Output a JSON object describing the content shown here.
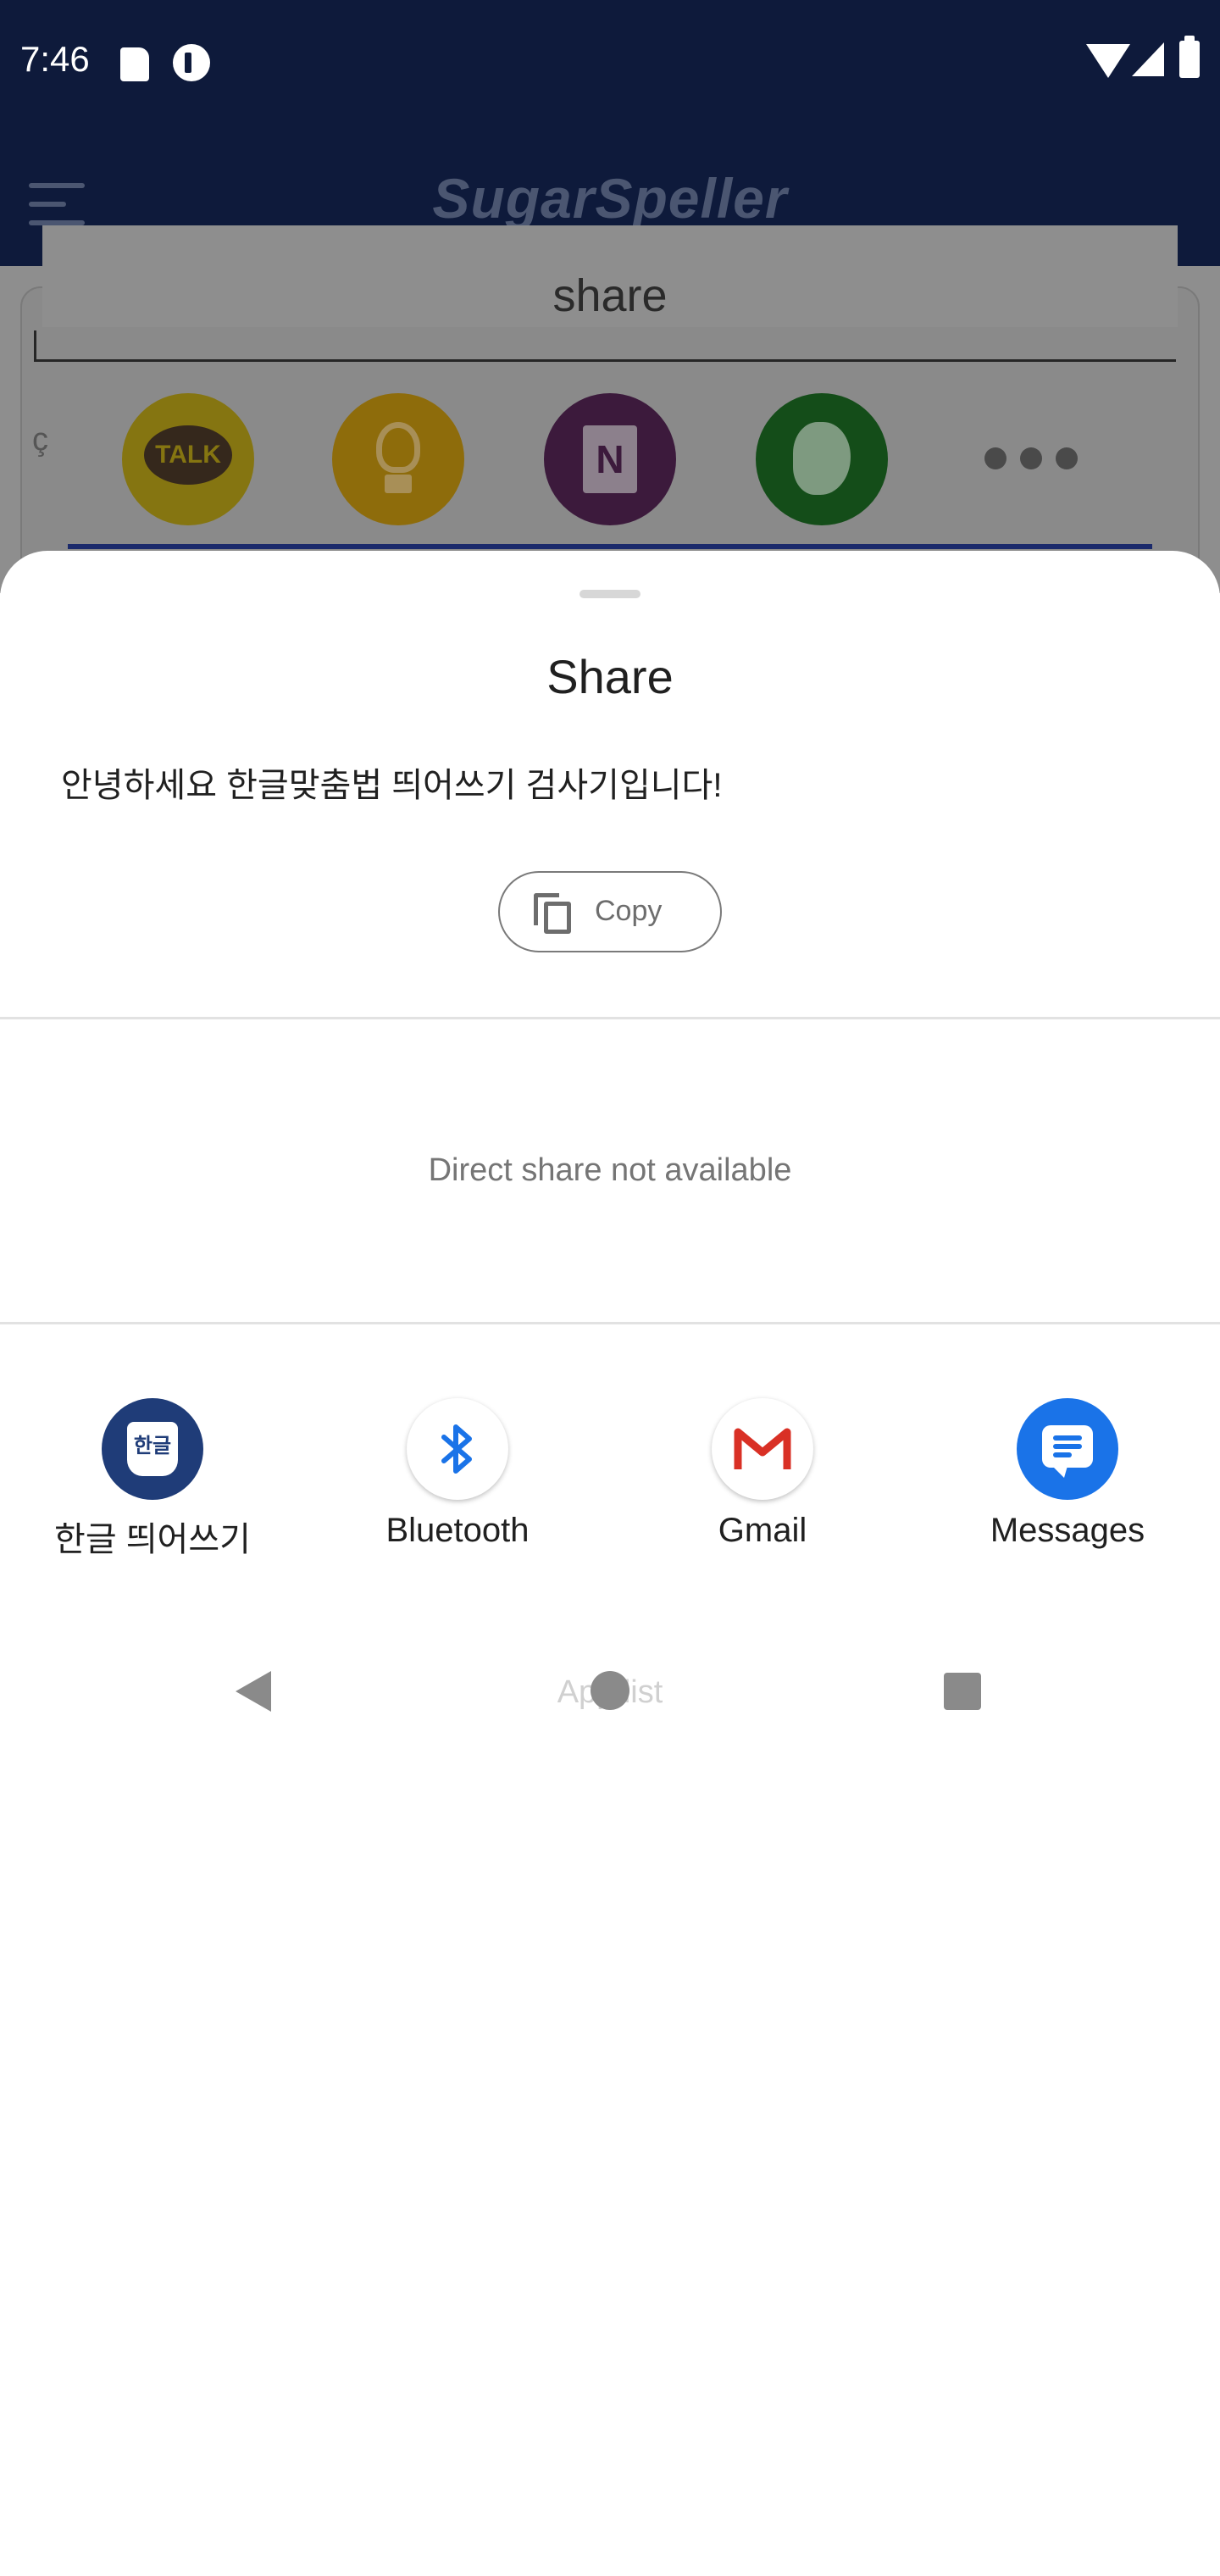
{
  "status_bar": {
    "time": "7:46",
    "icons": [
      "sd-card-icon",
      "dual-app-icon",
      "wifi-icon",
      "signal-icon",
      "battery-icon"
    ]
  },
  "background_app": {
    "title": "SugarSpeller",
    "panel_title": "share",
    "side_char": "ç",
    "share_targets": [
      {
        "name": "kakaotalk",
        "label": "TALK",
        "icon": "kakaotalk-icon",
        "color": "#857511"
      },
      {
        "name": "idea",
        "label": "",
        "icon": "lightbulb-icon",
        "color": "#8e6c0b"
      },
      {
        "name": "onenote",
        "label": "N",
        "icon": "onenote-icon",
        "color": "#3c1a3c"
      },
      {
        "name": "evernote",
        "label": "",
        "icon": "evernote-icon",
        "color": "#144d19"
      }
    ]
  },
  "sheet": {
    "title": "Share",
    "shared_text": "안녕하세요 한글맞춤법 띄어쓰기 검사기입니다!",
    "copy_label": "Copy",
    "direct_share": "Direct share not available",
    "targets": [
      {
        "label": "한글 띄어쓰기",
        "icon": "hangul-spacing-icon",
        "badge": "한글",
        "color": "#1f3c78"
      },
      {
        "label": "Bluetooth",
        "icon": "bluetooth-icon",
        "color": "#1a73e8"
      },
      {
        "label": "Gmail",
        "icon": "gmail-icon",
        "color": "#d93025"
      },
      {
        "label": "Messages",
        "icon": "messages-icon",
        "color": "#1a73e8"
      }
    ],
    "app_list_label": "App list"
  },
  "nav": {
    "buttons": [
      "back-icon",
      "home-icon",
      "recents-icon"
    ]
  }
}
